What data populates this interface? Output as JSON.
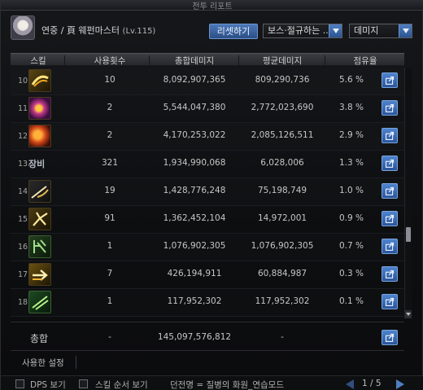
{
  "window": {
    "title": "전투 리포트"
  },
  "character": {
    "name": "연중 / 頁 웨펀마스터",
    "level": "(Lv.115)"
  },
  "toolbar": {
    "reset_label": "리셋하기",
    "boss_filter": "보스·절규하는 ..",
    "metric": "데미지"
  },
  "columns": [
    "스킬",
    "사용횟수",
    "총합데미지",
    "평균데미지",
    "점유율"
  ],
  "rows": [
    {
      "index": "10.",
      "uses": "10",
      "total": "8,092,907,365",
      "average": "809,290,736",
      "share": "5.6 %",
      "icon": "slash-arc-icon"
    },
    {
      "index": "11.",
      "uses": "2",
      "total": "5,544,047,380",
      "average": "2,772,023,690",
      "share": "3.8 %",
      "icon": "explosion-icon"
    },
    {
      "index": "12.",
      "uses": "2",
      "total": "4,170,253,022",
      "average": "2,085,126,511",
      "share": "2.9 %",
      "icon": "fire-burst-icon"
    },
    {
      "index": "13.",
      "uses": "321",
      "total": "1,934,990,068",
      "average": "6,028,006",
      "share": "1.3 %",
      "icon_text": "장비"
    },
    {
      "index": "14.",
      "uses": "19",
      "total": "1,428,776,248",
      "average": "75,198,749",
      "share": "1.0 %",
      "icon": "thrust-icon"
    },
    {
      "index": "15.",
      "uses": "91",
      "total": "1,362,452,104",
      "average": "14,972,001",
      "share": "0.9 %",
      "icon": "leap-strike-icon"
    },
    {
      "index": "16.",
      "uses": "1",
      "total": "1,076,902,305",
      "average": "1,076,902,305",
      "share": "0.7 %",
      "icon": "rune-icon"
    },
    {
      "index": "17.",
      "uses": "7",
      "total": "426,194,911",
      "average": "60,884,987",
      "share": "0.3 %",
      "icon": "charge-icon"
    },
    {
      "index": "18.",
      "uses": "1",
      "total": "117,952,302",
      "average": "117,952,302",
      "share": "0.1 %",
      "icon": "green-slash-icon"
    }
  ],
  "total": {
    "label": "총합",
    "uses": "-",
    "total": "145,097,576,812",
    "average": "-"
  },
  "settings": {
    "label": "사용한 설정"
  },
  "footer": {
    "dps_label": "DPS 보기",
    "order_label": "스킬 순서 보기",
    "dungeon": "던전명 = 질병의 화원_연습모드",
    "page": "1 / 5"
  },
  "colors": {
    "accent": "#3d6fb5",
    "row_text": "#c6c6c6",
    "background": "#0d0e10"
  }
}
